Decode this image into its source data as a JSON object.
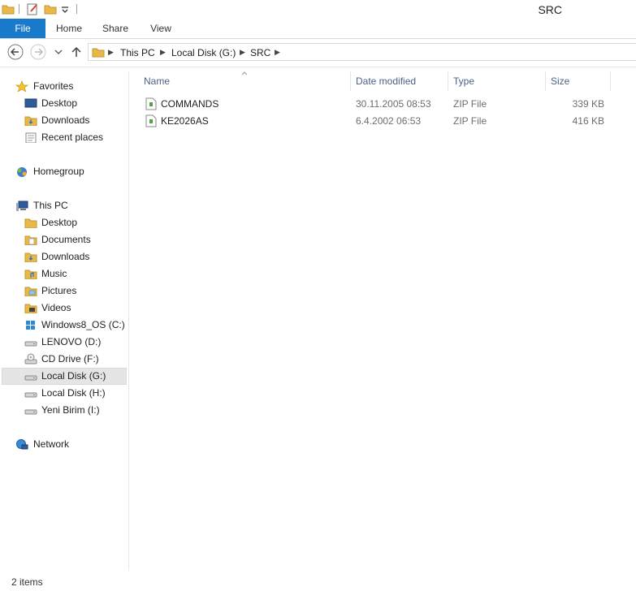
{
  "window": {
    "title": "SRC"
  },
  "ribbon": {
    "tabs": [
      "File",
      "Home",
      "Share",
      "View"
    ]
  },
  "address": {
    "crumbs": [
      "This PC",
      "Local Disk (G:)",
      "SRC"
    ]
  },
  "nav": {
    "favorites": {
      "label": "Favorites",
      "items": [
        "Desktop",
        "Downloads",
        "Recent places"
      ]
    },
    "homegroup": {
      "label": "Homegroup"
    },
    "thispc": {
      "label": "This PC",
      "items": [
        "Desktop",
        "Documents",
        "Downloads",
        "Music",
        "Pictures",
        "Videos",
        "Windows8_OS (C:)",
        "LENOVO (D:)",
        "CD Drive (F:)",
        "Local Disk (G:)",
        "Local Disk (H:)",
        "Yeni Birim (I:)"
      ]
    },
    "network": {
      "label": "Network"
    }
  },
  "columns": [
    "Name",
    "Date modified",
    "Type",
    "Size"
  ],
  "files": [
    {
      "name": "COMMANDS",
      "date": "30.11.2005 08:53",
      "type": "ZIP File",
      "size": "339 KB"
    },
    {
      "name": "KE2026AS",
      "date": "6.4.2002 06:53",
      "type": "ZIP File",
      "size": "416 KB"
    }
  ],
  "status": {
    "text": "2 items"
  },
  "colors": {
    "file_tab": "#1979ca",
    "folder": "#e8b94a",
    "header_text": "#4d6185"
  }
}
